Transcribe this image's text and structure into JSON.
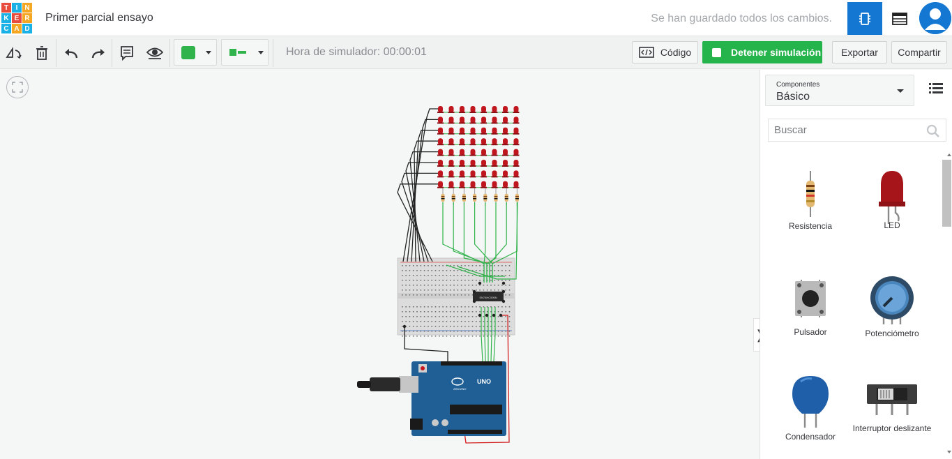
{
  "app": {
    "logo_letters": [
      "T",
      "I",
      "N",
      "K",
      "E",
      "R",
      "C",
      "A",
      "D"
    ],
    "logo_colors": [
      "#e74c3c",
      "#1ab1e6",
      "#f5a623",
      "#1ab1e6",
      "#e74c3c",
      "#f5a623",
      "#1ab1e6",
      "#f5a623",
      "#1ab1e6"
    ],
    "title": "Primer parcial ensayo",
    "save_status": "Se han guardado todos los cambios."
  },
  "colors": {
    "accent": "#1477d2",
    "sim_green": "#25b34b",
    "wire_green": "#2fb34a",
    "led_red": "#c0161e",
    "arduino_blue": "#1f5f96"
  },
  "toolbar": {
    "icons": [
      "rotate-icon",
      "delete-icon",
      "undo-icon",
      "redo-icon",
      "notes-icon",
      "visibility-icon"
    ],
    "sim_time": "Hora de simulador: 00:00:01",
    "code_label": "Código",
    "stop_label": "Detener simulación",
    "export_label": "Exportar",
    "share_label": "Compartir"
  },
  "panel": {
    "components_label": "Componentes",
    "components_value": "Básico",
    "search_placeholder": "Buscar",
    "parts": [
      {
        "label": "Resistencia",
        "icon": "resistor-icon"
      },
      {
        "label": "LED",
        "icon": "led-icon"
      },
      {
        "label": "Pulsador",
        "icon": "pushbutton-icon"
      },
      {
        "label": "Potenciómetro",
        "icon": "potentiometer-icon"
      },
      {
        "label": "Condensador",
        "icon": "capacitor-icon"
      },
      {
        "label": "Interruptor deslizante",
        "icon": "slide-switch-icon"
      }
    ]
  },
  "circuit": {
    "led_matrix": {
      "rows": 8,
      "cols": 8
    },
    "resistor_count": 8,
    "ic_label": "SN74HC595N",
    "board_label": "UNO",
    "board_brand": "ARDUINO"
  }
}
